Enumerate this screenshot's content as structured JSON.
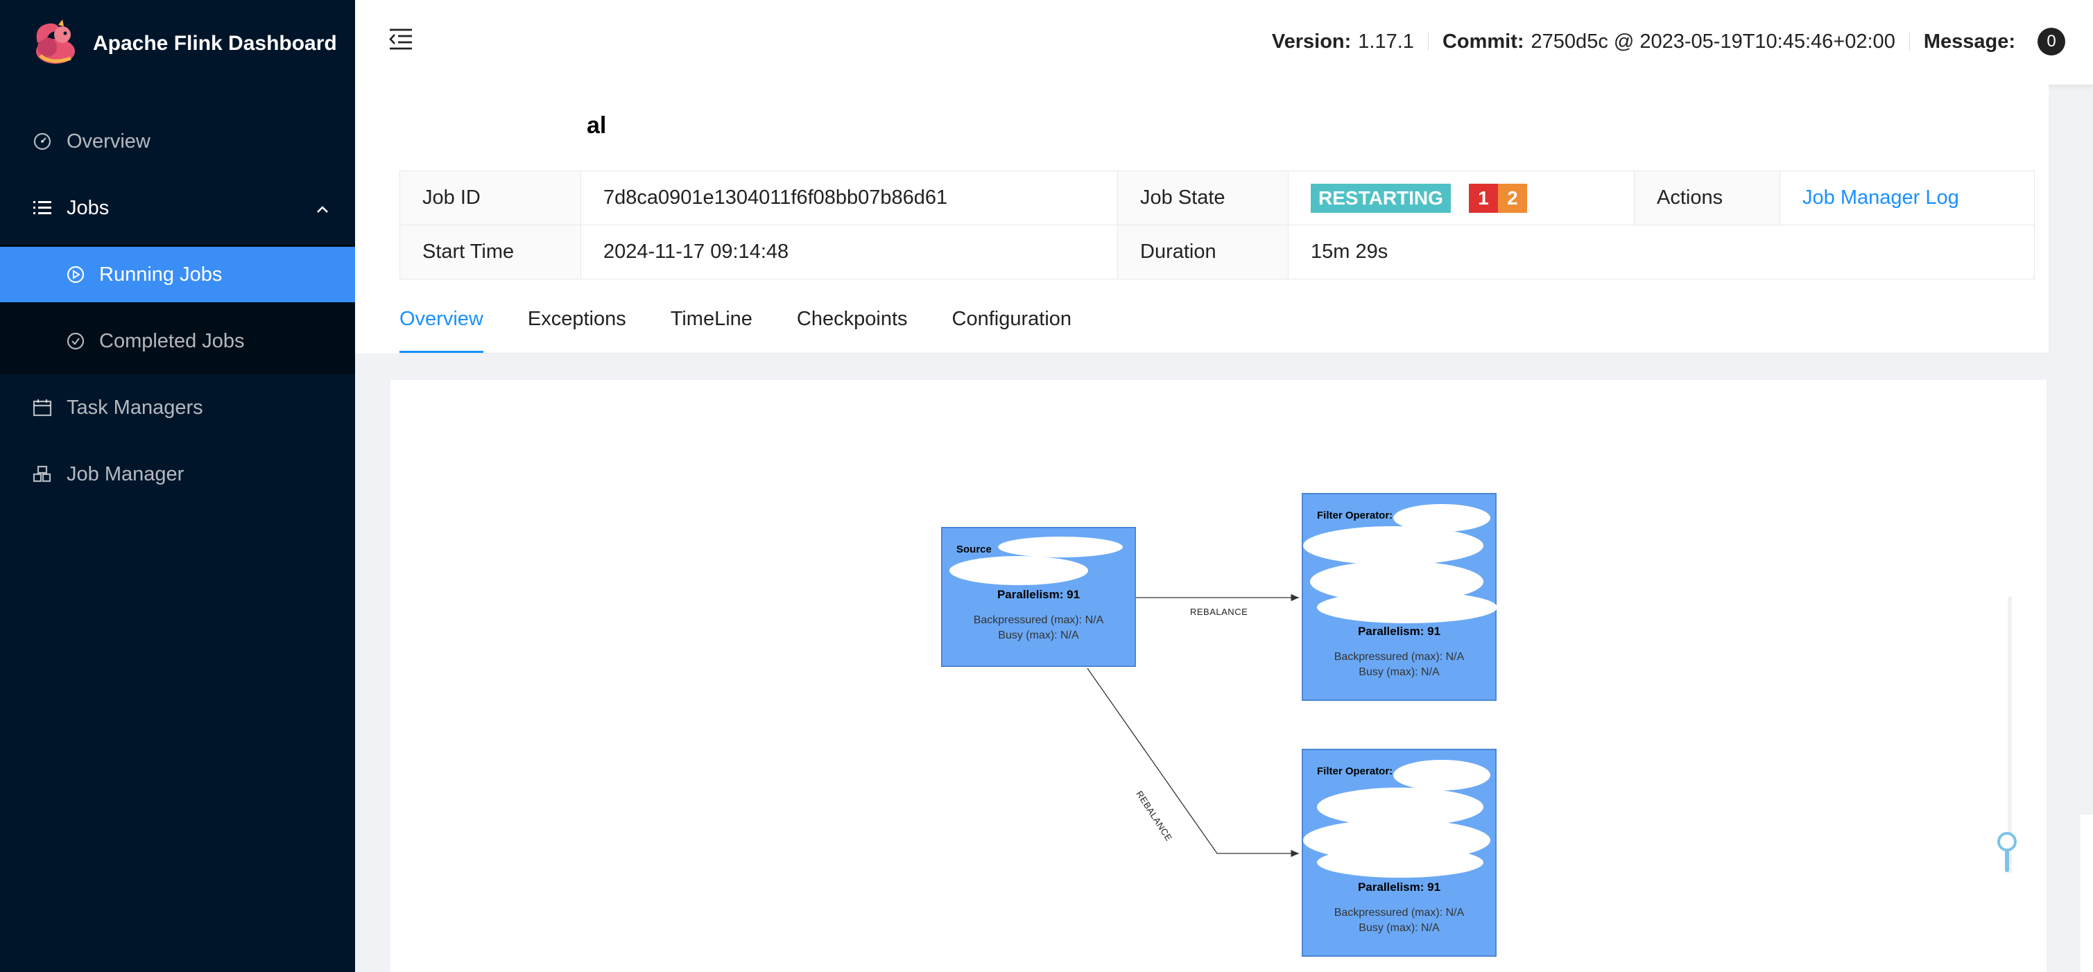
{
  "app": {
    "title": "Apache Flink Dashboard"
  },
  "sidebar": {
    "items": [
      {
        "label": "Overview",
        "icon": "dashboard-icon"
      },
      {
        "label": "Jobs",
        "icon": "list-icon"
      },
      {
        "label": "Running Jobs",
        "icon": "play-circle-icon"
      },
      {
        "label": "Completed Jobs",
        "icon": "check-circle-icon"
      },
      {
        "label": "Task Managers",
        "icon": "calendar-icon"
      },
      {
        "label": "Job Manager",
        "icon": "cluster-icon"
      }
    ]
  },
  "header": {
    "version_label": "Version:",
    "version": "1.17.1",
    "commit_label": "Commit:",
    "commit": "2750d5c @ 2023-05-19T10:45:46+02:00",
    "message_label": "Message:",
    "message_count": "0"
  },
  "job": {
    "name_visible": "al",
    "id_label": "Job ID",
    "id": "7d8ca0901e1304011f6f08bb07b86d61",
    "state_label": "Job State",
    "state": "RESTARTING",
    "state_color": "#4fc1c6",
    "count_failed": "1",
    "count_other": "2",
    "actions_label": "Actions",
    "action_link": "Job Manager Log",
    "start_label": "Start Time",
    "start": "2024-11-17 09:14:48",
    "duration_label": "Duration",
    "duration": "15m 29s"
  },
  "tabs": [
    {
      "label": "Overview",
      "active": true
    },
    {
      "label": "Exceptions"
    },
    {
      "label": "TimeLine"
    },
    {
      "label": "Checkpoints"
    },
    {
      "label": "Configuration"
    }
  ],
  "graph": {
    "nodes": [
      {
        "label": "Source",
        "parallelism": "Parallelism: 91",
        "backpressured": "Backpressured (max): N/A",
        "busy": "Busy (max): N/A"
      },
      {
        "label": "Filter Operator:",
        "parallelism": "Parallelism: 91",
        "backpressured": "Backpressured (max): N/A",
        "busy": "Busy (max): N/A"
      },
      {
        "label": "Filter Operator:",
        "parallelism": "Parallelism: 91",
        "backpressured": "Backpressured (max): N/A",
        "busy": "Busy (max): N/A"
      }
    ],
    "edges": [
      {
        "label": "REBALANCE"
      },
      {
        "label": "REBALANCE"
      }
    ]
  }
}
